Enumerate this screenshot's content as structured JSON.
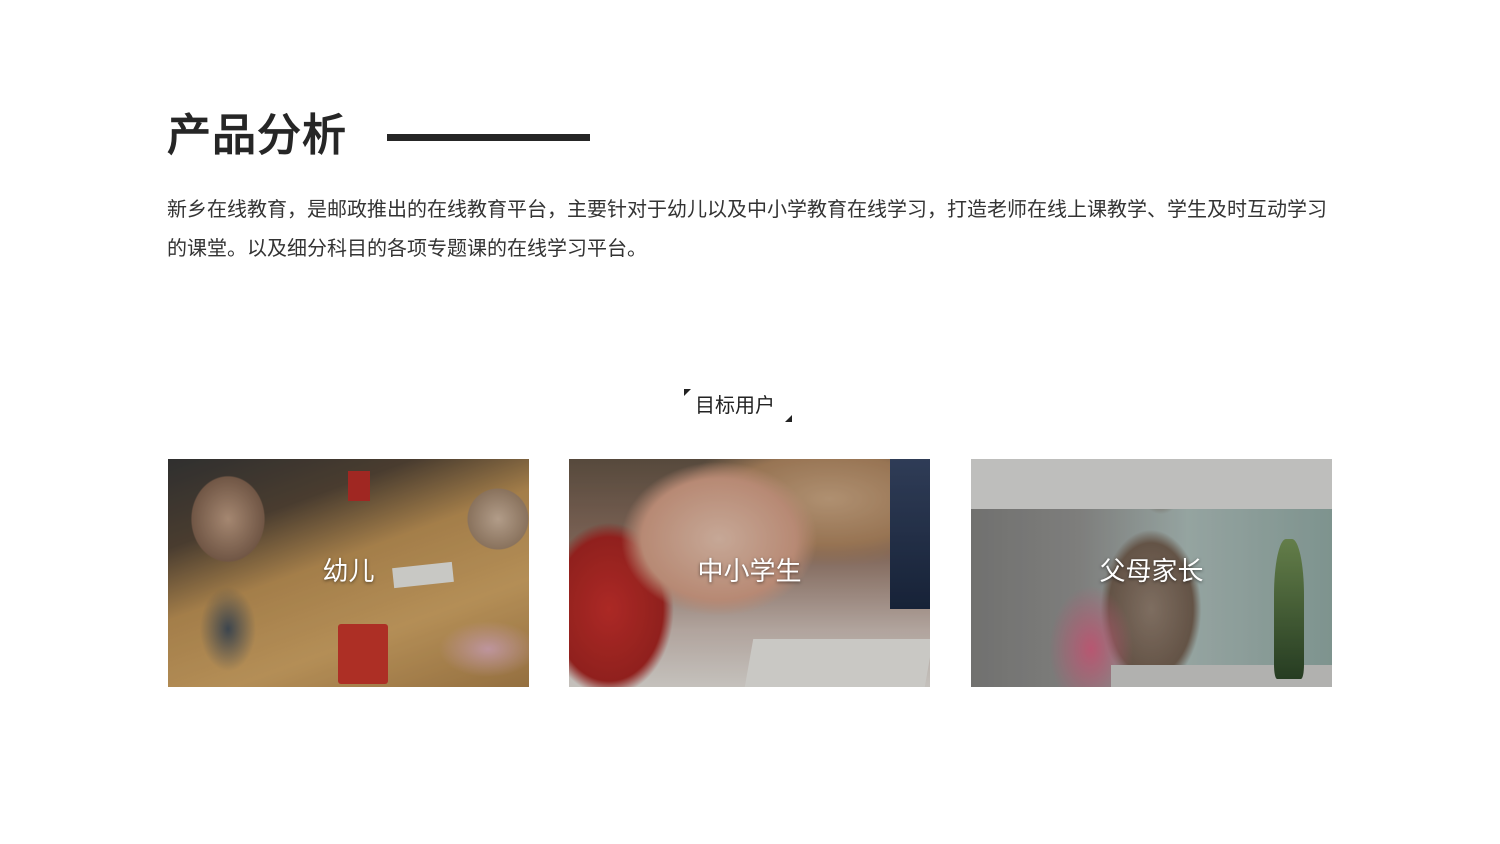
{
  "header": {
    "title": "产品分析"
  },
  "intro": {
    "text": "新乡在线教育，是邮政推出的在线教育平台，主要针对于幼儿以及中小学教育在线学习，打造老师在线上课教学、学生及时互动学习的课堂。以及细分科目的各项专题课的在线学习平台。"
  },
  "section": {
    "label": "目标用户"
  },
  "cards": [
    {
      "label": "幼儿"
    },
    {
      "label": "中小学生"
    },
    {
      "label": "父母家长"
    }
  ]
}
